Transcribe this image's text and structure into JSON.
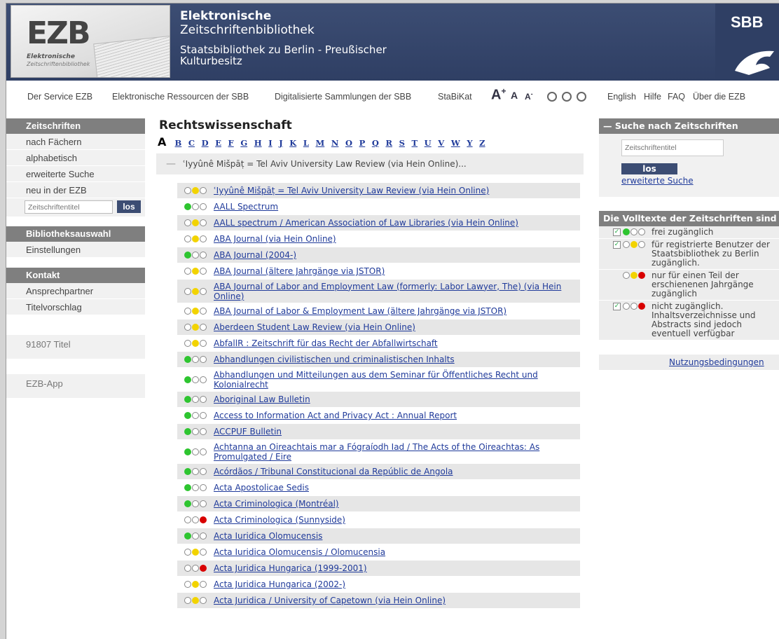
{
  "header": {
    "logo_text": "EZB",
    "logo_sub1": "Elektronische",
    "logo_sub2": "Zeitschriftenbibliothek",
    "title_line1": "Elektronische",
    "title_line2": "Zeitschriftenbibliothek",
    "institution_line1": "Staatsbibliothek zu Berlin - Preußischer",
    "institution_line2": "Kulturbesitz",
    "sbb_logo": "SBB"
  },
  "topnav": {
    "links": [
      "Der Service EZB",
      "Elektronische Ressourcen der SBB",
      "Digitalisierte Sammlungen der SBB",
      "StaBiKat"
    ],
    "font_size_big": "A",
    "font_size_mid": "A",
    "font_size_small": "A",
    "plus": "+",
    "minus": "-",
    "right_links": [
      "English",
      "Hilfe",
      "FAQ",
      "Über die EZB"
    ]
  },
  "left": {
    "head1": "Zeitschriften",
    "items1": [
      "nach Fächern",
      "alphabetisch",
      "erweiterte Suche",
      "neu in der EZB"
    ],
    "search_placeholder": "Zeitschriftentitel",
    "search_button": "los",
    "head2": "Bibliotheksauswahl",
    "items2": [
      "Einstellungen"
    ],
    "head3": "Kontakt",
    "items3": [
      "Ansprechpartner",
      "Titelvorschlag"
    ],
    "count": "91807 Titel",
    "app": "EZB-App"
  },
  "main": {
    "title": "Rechtswissenschaft",
    "current_letter": "A",
    "letters": [
      "B",
      "C",
      "D",
      "E",
      "F",
      "G",
      "H",
      "I",
      "J",
      "K",
      "L",
      "M",
      "N",
      "O",
      "P",
      "Q",
      "R",
      "S",
      "T",
      "U",
      "V",
      "W",
      "Y",
      "Z"
    ],
    "subhead": "ʿIyyûnê Mišpāṭ = Tel Aviv University Law Review (via Hein Online)...",
    "rows": [
      {
        "title": "ʿIyyûnê Mišpāṭ = Tel Aviv University Law Review (via Hein Online)",
        "dots": [
          "empty",
          "yellow",
          "empty"
        ]
      },
      {
        "title": "AALL Spectrum",
        "dots": [
          "green",
          "empty",
          "empty"
        ]
      },
      {
        "title": "AALL spectrum / American Association of Law Libraries (via Hein Online)",
        "dots": [
          "empty",
          "yellow",
          "empty"
        ]
      },
      {
        "title": "ABA Journal (via Hein Online)",
        "dots": [
          "empty",
          "yellow",
          "empty"
        ]
      },
      {
        "title": "ABA Journal (2004-)",
        "dots": [
          "green",
          "empty",
          "empty"
        ]
      },
      {
        "title": "ABA Journal (ältere Jahrgänge via JSTOR)",
        "dots": [
          "empty",
          "yellow",
          "empty"
        ]
      },
      {
        "title": "ABA Journal of Labor and Employment Law (formerly: Labor Lawyer, The) (via Hein Online)",
        "dots": [
          "empty",
          "yellow",
          "empty"
        ]
      },
      {
        "title": "ABA Journal of Labor & Employment Law (ältere Jahrgänge via JSTOR)",
        "dots": [
          "empty",
          "yellow",
          "empty"
        ]
      },
      {
        "title": "Aberdeen Student Law Review (via Hein Online)",
        "dots": [
          "empty",
          "yellow",
          "empty"
        ]
      },
      {
        "title": "AbfallR : Zeitschrift für das Recht der Abfallwirtschaft",
        "dots": [
          "empty",
          "yellow",
          "empty"
        ]
      },
      {
        "title": "Abhandlungen civilistischen und criminalistischen Inhalts",
        "dots": [
          "green",
          "empty",
          "empty"
        ]
      },
      {
        "title": "Abhandlungen und Mitteilungen aus dem Seminar für Öffentliches Recht und Kolonialrecht",
        "dots": [
          "green",
          "empty",
          "empty"
        ]
      },
      {
        "title": "Aboriginal Law Bulletin",
        "dots": [
          "green",
          "empty",
          "empty"
        ]
      },
      {
        "title": "Access to Information Act and Privacy Act : Annual Report",
        "dots": [
          "green",
          "empty",
          "empty"
        ]
      },
      {
        "title": "ACCPUF Bulletin",
        "dots": [
          "green",
          "empty",
          "empty"
        ]
      },
      {
        "title": "Achtanna an Oireachtais mar a Fógraíodh Iad / The Acts of the Oireachtas: As Promulgated / Eire",
        "dots": [
          "green",
          "empty",
          "empty"
        ]
      },
      {
        "title": "Acórdãos / Tribunal Constitucional da Repúblic de Angola",
        "dots": [
          "green",
          "empty",
          "empty"
        ]
      },
      {
        "title": "Acta Apostolicae Sedis",
        "dots": [
          "green",
          "empty",
          "empty"
        ]
      },
      {
        "title": "Acta Criminologica (Montréal)",
        "dots": [
          "green",
          "empty",
          "empty"
        ]
      },
      {
        "title": "Acta Criminologica (Sunnyside)",
        "dots": [
          "empty",
          "empty",
          "red"
        ]
      },
      {
        "title": "Acta Iuridica Olomucensis",
        "dots": [
          "green",
          "empty",
          "empty"
        ]
      },
      {
        "title": "Acta Iuridica Olomucensis / Olomucensia",
        "dots": [
          "empty",
          "yellow",
          "empty"
        ]
      },
      {
        "title": "Acta Juridica Hungarica (1999-2001)",
        "dots": [
          "empty",
          "empty",
          "red"
        ]
      },
      {
        "title": "Acta Juridica Hungarica (2002-)",
        "dots": [
          "empty",
          "yellow",
          "empty"
        ]
      },
      {
        "title": "Acta Juridica / University of Capetown (via Hein Online)",
        "dots": [
          "empty",
          "yellow",
          "empty"
        ]
      }
    ]
  },
  "right": {
    "search_head": "Suche nach Zeitschriften",
    "search_placeholder": "Zeitschriftentitel",
    "search_button": "los",
    "adv_link": "erweiterte Suche",
    "legend_head": "Die Volltexte der Zeitschriften sind",
    "legend": [
      {
        "text": "frei zugänglich",
        "checked": true,
        "dots": [
          "green",
          "empty",
          "empty"
        ]
      },
      {
        "text": "für registrierte Benutzer der Staatsbibliothek zu Berlin zugänglich.",
        "checked": true,
        "dots": [
          "empty",
          "yellow",
          "empty"
        ]
      },
      {
        "text": "nur für einen Teil der erschienenen Jahrgänge zugänglich",
        "checked": false,
        "dots": [
          "empty",
          "yellow",
          "red"
        ]
      },
      {
        "text": "nicht zugänglich. Inhaltsverzeichnisse und Abstracts sind jedoch eventuell verfügbar",
        "checked": true,
        "dots": [
          "empty",
          "empty",
          "red"
        ]
      }
    ],
    "terms_link": "Nutzungsbedingungen"
  },
  "colors": {
    "header_bg": "#2f3f64",
    "dot_green": "#2ec530",
    "dot_yellow": "#f2d300",
    "dot_red": "#d80000",
    "link": "#1f3a9a"
  }
}
